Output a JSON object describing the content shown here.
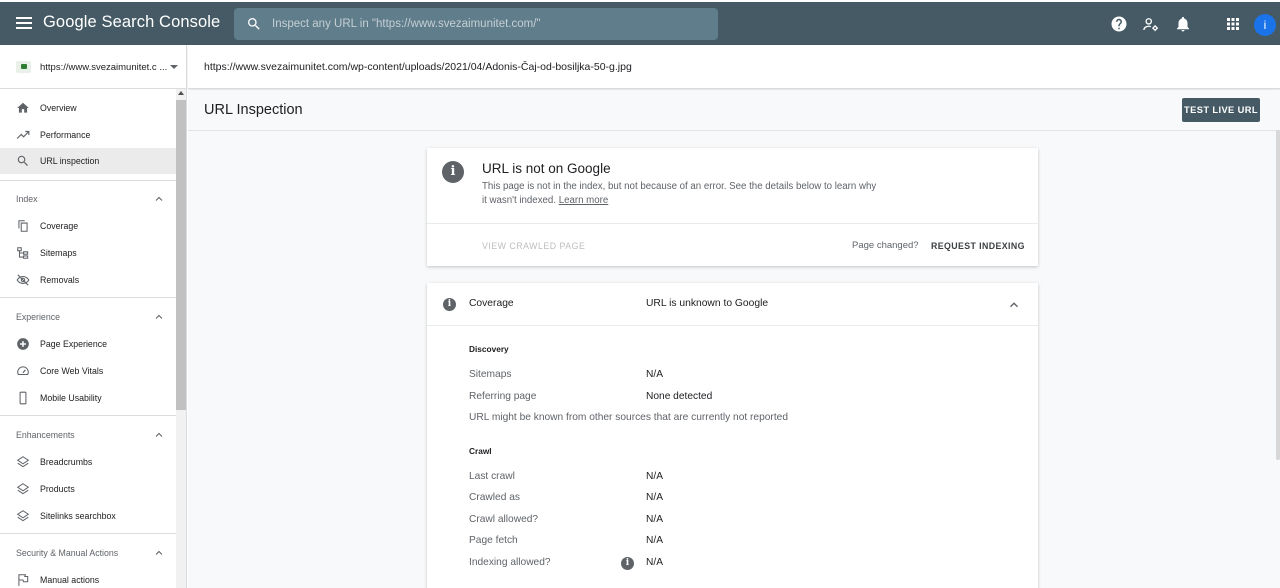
{
  "app": {
    "brand": "Google Search Console",
    "search_placeholder": "Inspect any URL in \"https://www.svezaimunitet.com/\"",
    "avatar_letter": "i",
    "accent_color": "#455a64"
  },
  "property": {
    "label": "https://www.svezaimunitet.c ..."
  },
  "inspected_url": "https://www.svezaimunitet.com/wp-content/uploads/2021/04/Adonis-Čaj-od-bosiljka-50-g.jpg",
  "sidebar": {
    "items_top": [
      {
        "label": "Overview",
        "icon": "home-icon"
      },
      {
        "label": "Performance",
        "icon": "trending-up-icon"
      },
      {
        "label": "URL inspection",
        "icon": "search-icon"
      }
    ],
    "index": {
      "header": "Index",
      "items": [
        {
          "label": "Coverage",
          "icon": "copy-icon"
        },
        {
          "label": "Sitemaps",
          "icon": "sitemap-icon"
        },
        {
          "label": "Removals",
          "icon": "visibility-off-icon"
        }
      ]
    },
    "experience": {
      "header": "Experience",
      "items": [
        {
          "label": "Page Experience",
          "icon": "add-circle-icon"
        },
        {
          "label": "Core Web Vitals",
          "icon": "speed-icon"
        },
        {
          "label": "Mobile Usability",
          "icon": "phone-icon"
        }
      ]
    },
    "enhancements": {
      "header": "Enhancements",
      "items": [
        {
          "label": "Breadcrumbs",
          "icon": "layers-icon"
        },
        {
          "label": "Products",
          "icon": "layers-icon"
        },
        {
          "label": "Sitelinks searchbox",
          "icon": "layers-icon"
        }
      ]
    },
    "security": {
      "header": "Security & Manual Actions",
      "items": [
        {
          "label": "Manual actions",
          "icon": "flag-icon"
        }
      ]
    }
  },
  "page": {
    "title": "URL Inspection",
    "test_live_label": "TEST LIVE URL"
  },
  "status": {
    "title": "URL is not on Google",
    "description": "This page is not in the index, but not because of an error. See the details below to learn why it wasn't indexed.",
    "learn_more": "Learn more",
    "view_crawled": "VIEW CRAWLED PAGE",
    "page_changed": "Page changed?",
    "request_indexing": "REQUEST INDEXING"
  },
  "coverage": {
    "label": "Coverage",
    "value": "URL is unknown to Google",
    "discovery": {
      "title": "Discovery",
      "sitemaps_label": "Sitemaps",
      "sitemaps_value": "N/A",
      "referring_label": "Referring page",
      "referring_value": "None detected",
      "note": "URL might be known from other sources that are currently not reported"
    },
    "crawl": {
      "title": "Crawl",
      "rows": [
        {
          "label": "Last crawl",
          "value": "N/A"
        },
        {
          "label": "Crawled as",
          "value": "N/A"
        },
        {
          "label": "Crawl allowed?",
          "value": "N/A"
        },
        {
          "label": "Page fetch",
          "value": "N/A"
        },
        {
          "label": "Indexing allowed?",
          "value": "N/A"
        }
      ]
    }
  }
}
